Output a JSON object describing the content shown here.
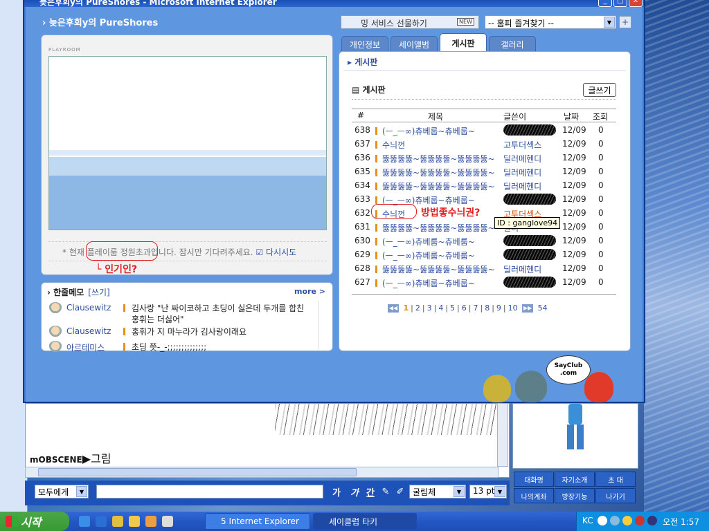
{
  "window": {
    "title": "늦은후회y의 PureShores - Microsoft Internet Explorer",
    "site_title": "늦은후회y의 PureShores"
  },
  "top": {
    "gift_label": "밍 서비스 선물하기",
    "gift_badge": "NEW",
    "favorites_value": "-- 홈피 즐겨찾기 --",
    "plus_label": "+"
  },
  "playroom": {
    "label": "PLAYROOM",
    "message_prefix": "* 현재",
    "message_circled": "플레이룸 정원초과",
    "message_suffix": "입니다. 잠시만 기다려주세요.",
    "retry_label": "다시시도",
    "annotation": "└ 인기인?"
  },
  "memo": {
    "title": "한줄메모",
    "write_label": "[쓰기]",
    "more_label": "more >",
    "rows": [
      {
        "nick": "Clausewitz",
        "text": "김사랑 \"난 싸이코하고 초딩이 싫은데 두개를 합친 홍휘는 더싫어\""
      },
      {
        "nick": "Clausewitz",
        "text": "홍휘가 지 마누라가 김사랑이래요"
      },
      {
        "nick": "아르테미스",
        "text": "초딩 쯧-_-;;;;;;;;;;;;;;"
      }
    ]
  },
  "tabs": [
    "개인정보",
    "세이앨범",
    "게시판",
    "갤러리"
  ],
  "board": {
    "crumb": "게시판",
    "section": "게시판",
    "write_button": "글쓰기",
    "headers": {
      "num": "#",
      "subject": "제목",
      "author": "글쓴이",
      "date": "날짜",
      "views": "조회"
    },
    "rows": [
      {
        "num": "638",
        "subject": "(ㅡ_ㅡ∞)츄베룹~츄베룹~",
        "author": "",
        "date": "12/09",
        "views": "0"
      },
      {
        "num": "637",
        "subject": "수늬껀",
        "author": "고투더섹스",
        "date": "12/09",
        "views": "0"
      },
      {
        "num": "636",
        "subject": "뚫뚫뚫뚫~뚫뚫뚫뚫~뚫뚫뚫뚫~",
        "author": "딜러메헨디",
        "date": "12/09",
        "views": "0"
      },
      {
        "num": "635",
        "subject": "뚫뚫뚫뚫~뚫뚫뚫뚫~뚫뚫뚫뚫~",
        "author": "딜러메헨디",
        "date": "12/09",
        "views": "0"
      },
      {
        "num": "634",
        "subject": "뚫뚫뚫뚫~뚫뚫뚫뚫~뚫뚫뚫뚫~",
        "author": "딜러메헨디",
        "date": "12/09",
        "views": "0"
      },
      {
        "num": "633",
        "subject": "(ㅡ_ㅡ∞)츄베룹~츄베룹~",
        "author": "",
        "date": "12/09",
        "views": "0"
      },
      {
        "num": "632",
        "subject": "수늬껀",
        "author": "고투더섹스",
        "date": "12/09",
        "views": "0"
      },
      {
        "num": "631",
        "subject": "뚫뚫뚫뚫~뚫뚫뚫뚫~뚫뚫뚫뚫~",
        "author": "딜러",
        "date": "12/09",
        "views": "0"
      },
      {
        "num": "630",
        "subject": "(ㅡ_ㅡ∞)츄베룹~츄베룹~",
        "author": "",
        "date": "12/09",
        "views": "0"
      },
      {
        "num": "629",
        "subject": "(ㅡ_ㅡ∞)츄베룹~츄베룹~",
        "author": "",
        "date": "12/09",
        "views": "0"
      },
      {
        "num": "628",
        "subject": "뚫뚫뚫뚫~뚫뚫뚫뚫~뚫뚫뚫뚫~",
        "author": "딜러메헨디",
        "date": "12/09",
        "views": "0"
      },
      {
        "num": "627",
        "subject": "(ㅡ_ㅡ∞)츄베룹~츄베룹~",
        "author": "",
        "date": "12/09",
        "views": "0"
      }
    ],
    "annotation": "방법좋수늬권?",
    "tooltip": "ID : ganglove94",
    "pages": [
      "1",
      "2",
      "3",
      "4",
      "5",
      "6",
      "7",
      "8",
      "9",
      "10"
    ],
    "last_page": "54"
  },
  "mascot": {
    "bubble_line1": "SayClub",
    "bubble_line2": ".com"
  },
  "chat": {
    "nick": "mOBSCENE",
    "message": "그림",
    "target_select": "모두에게",
    "font_select": "굴림체",
    "size_select": "13 pt",
    "format_buttons": [
      "가",
      "가",
      "간"
    ]
  },
  "side_buttons": [
    "대화명",
    "자기소개",
    "초 대",
    "나의계좌",
    "방장기능",
    "나가기"
  ],
  "taskbar": {
    "start_label": "시작",
    "items": [
      "5 Internet Explorer",
      "세이클럽 타키"
    ],
    "tray_lang": "KC",
    "clock": "오전 1:57"
  }
}
